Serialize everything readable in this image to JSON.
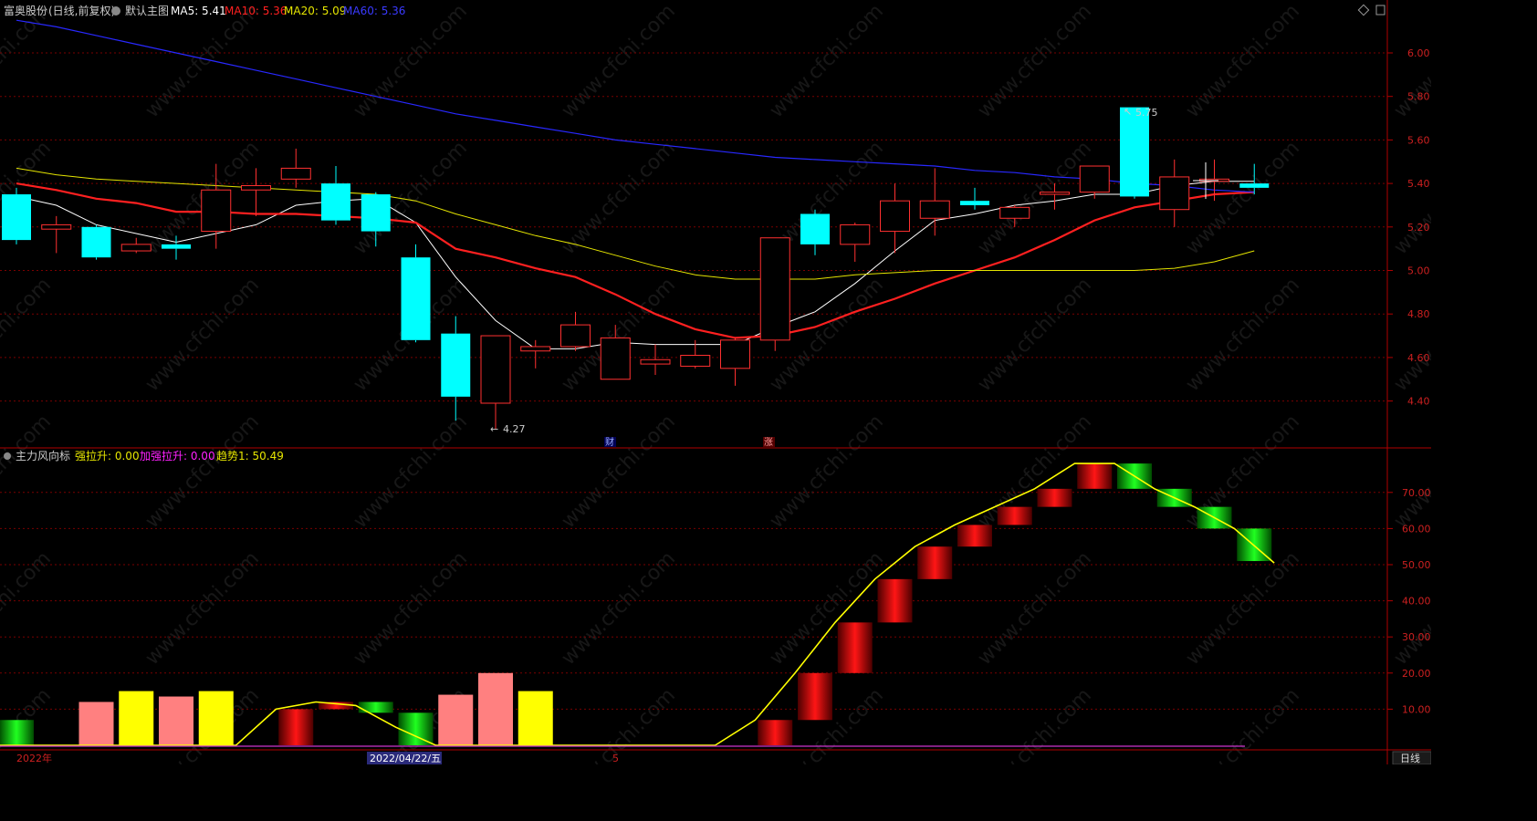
{
  "header": {
    "stock_name": "富奥股份",
    "period": "(日线,前复权)",
    "main_chart_label": "默认主图",
    "ma5": "MA5: 5.41",
    "ma10": "MA10: 5.36",
    "ma20": "MA20: 5.09",
    "ma60": "MA60: 5.36"
  },
  "sub_header": {
    "indicator_name": "主力风向标",
    "strong_pull": "强拉升: 0.00",
    "accel_pull": "加强拉升: 0.00",
    "trend": "趋势1: 50.49"
  },
  "annotations": {
    "high_label": "5.75",
    "low_label": "4.27",
    "marker_cai": "财",
    "marker_zhang": "涨"
  },
  "x_axis": {
    "year_label": "2022年",
    "cursor_date": "2022/04/22/五",
    "month_label": "5",
    "period_button": "日线"
  },
  "watermark": "www.cfchi.com",
  "colors": {
    "up": "#ff3030",
    "down": "#00ffff",
    "ma5": "#ffffff",
    "ma10": "#ff2020",
    "ma20": "#e5e500",
    "ma60": "#2828ff",
    "trend": "#ffff00",
    "grid": "#7a0000",
    "axis": "#b00000"
  },
  "chart_data": [
    {
      "type": "candlestick",
      "y_ticks": [
        "6.00",
        "5.80",
        "5.60",
        "5.40",
        "5.20",
        "5.00",
        "4.80",
        "4.60",
        "4.40"
      ],
      "ylim": [
        4.2,
        6.2
      ],
      "candles": [
        {
          "o": 5.35,
          "h": 5.38,
          "l": 5.12,
          "c": 5.14
        },
        {
          "o": 5.19,
          "h": 5.25,
          "l": 5.08,
          "c": 5.21
        },
        {
          "o": 5.2,
          "h": 5.21,
          "l": 5.05,
          "c": 5.06
        },
        {
          "o": 5.09,
          "h": 5.15,
          "l": 5.08,
          "c": 5.12
        },
        {
          "o": 5.12,
          "h": 5.16,
          "l": 5.05,
          "c": 5.1
        },
        {
          "o": 5.18,
          "h": 5.49,
          "l": 5.1,
          "c": 5.37
        },
        {
          "o": 5.37,
          "h": 5.47,
          "l": 5.25,
          "c": 5.39
        },
        {
          "o": 5.42,
          "h": 5.56,
          "l": 5.38,
          "c": 5.47
        },
        {
          "o": 5.4,
          "h": 5.48,
          "l": 5.21,
          "c": 5.23
        },
        {
          "o": 5.35,
          "h": 5.36,
          "l": 5.11,
          "c": 5.18
        },
        {
          "o": 5.06,
          "h": 5.12,
          "l": 4.67,
          "c": 4.68
        },
        {
          "o": 4.71,
          "h": 4.79,
          "l": 4.31,
          "c": 4.42
        },
        {
          "o": 4.39,
          "h": 4.7,
          "l": 4.27,
          "c": 4.7
        },
        {
          "o": 4.63,
          "h": 4.68,
          "l": 4.55,
          "c": 4.65
        },
        {
          "o": 4.65,
          "h": 4.81,
          "l": 4.63,
          "c": 4.75
        },
        {
          "o": 4.5,
          "h": 4.75,
          "l": 4.5,
          "c": 4.69
        },
        {
          "o": 4.57,
          "h": 4.66,
          "l": 4.52,
          "c": 4.59
        },
        {
          "o": 4.56,
          "h": 4.68,
          "l": 4.55,
          "c": 4.61
        },
        {
          "o": 4.55,
          "h": 4.69,
          "l": 4.47,
          "c": 4.68
        },
        {
          "o": 4.68,
          "h": 5.15,
          "l": 4.63,
          "c": 5.15
        },
        {
          "o": 5.26,
          "h": 5.28,
          "l": 5.07,
          "c": 5.12
        },
        {
          "o": 5.12,
          "h": 5.22,
          "l": 5.04,
          "c": 5.21
        },
        {
          "o": 5.18,
          "h": 5.4,
          "l": 5.08,
          "c": 5.32
        },
        {
          "o": 5.24,
          "h": 5.47,
          "l": 5.16,
          "c": 5.32
        },
        {
          "o": 5.32,
          "h": 5.38,
          "l": 5.28,
          "c": 5.3
        },
        {
          "o": 5.24,
          "h": 5.3,
          "l": 5.2,
          "c": 5.29
        },
        {
          "o": 5.35,
          "h": 5.4,
          "l": 5.28,
          "c": 5.36
        },
        {
          "o": 5.36,
          "h": 5.48,
          "l": 5.33,
          "c": 5.48
        },
        {
          "o": 5.75,
          "h": 5.75,
          "l": 5.33,
          "c": 5.34
        },
        {
          "o": 5.28,
          "h": 5.51,
          "l": 5.2,
          "c": 5.43
        },
        {
          "o": 5.41,
          "h": 5.51,
          "l": 5.32,
          "c": 5.42
        },
        {
          "o": 5.4,
          "h": 5.49,
          "l": 5.35,
          "c": 5.38
        }
      ],
      "series": [
        {
          "name": "MA5",
          "values": [
            5.34,
            5.3,
            5.21,
            5.17,
            5.13,
            5.17,
            5.21,
            5.3,
            5.32,
            5.33,
            5.22,
            4.97,
            4.77,
            4.64,
            4.64,
            4.67,
            4.66,
            4.66,
            4.66,
            4.74,
            4.81,
            4.94,
            5.09,
            5.23,
            5.26,
            5.3,
            5.32,
            5.35,
            5.35,
            5.39,
            5.41,
            5.41
          ]
        },
        {
          "name": "MA10",
          "values": [
            5.4,
            5.37,
            5.33,
            5.31,
            5.27,
            5.27,
            5.26,
            5.26,
            5.25,
            5.24,
            5.22,
            5.1,
            5.06,
            5.01,
            4.97,
            4.89,
            4.8,
            4.73,
            4.69,
            4.7,
            4.74,
            4.81,
            4.87,
            4.94,
            5.0,
            5.06,
            5.14,
            5.23,
            5.29,
            5.32,
            5.35,
            5.36
          ]
        },
        {
          "name": "MA20",
          "values": [
            5.47,
            5.44,
            5.42,
            5.41,
            5.4,
            5.39,
            5.38,
            5.37,
            5.36,
            5.35,
            5.32,
            5.26,
            5.21,
            5.16,
            5.12,
            5.07,
            5.02,
            4.98,
            4.96,
            4.96,
            4.96,
            4.98,
            4.99,
            5.0,
            5.0,
            5.0,
            5.0,
            5.0,
            5.0,
            5.01,
            5.04,
            5.09
          ]
        },
        {
          "name": "MA60",
          "values": [
            6.15,
            6.12,
            6.08,
            6.04,
            6.0,
            5.96,
            5.92,
            5.88,
            5.84,
            5.8,
            5.76,
            5.72,
            5.69,
            5.66,
            5.63,
            5.6,
            5.58,
            5.56,
            5.54,
            5.52,
            5.51,
            5.5,
            5.49,
            5.48,
            5.46,
            5.45,
            5.43,
            5.42,
            5.4,
            5.39,
            5.37,
            5.36
          ]
        }
      ]
    },
    {
      "type": "bar",
      "title": "主力风向标",
      "y_ticks": [
        "70.00",
        "60.00",
        "50.00",
        "40.00",
        "30.00",
        "20.00",
        "10.00"
      ],
      "ylim": [
        0,
        80
      ],
      "bars": [
        {
          "lo": 0,
          "hi": 7,
          "color": "green"
        },
        {
          "lo": 0,
          "hi": 0,
          "color": "none"
        },
        {
          "lo": 0,
          "hi": 12,
          "color": "pink"
        },
        {
          "lo": 0,
          "hi": 15,
          "color": "yellow"
        },
        {
          "lo": 0,
          "hi": 13.5,
          "color": "pink"
        },
        {
          "lo": 0,
          "hi": 15,
          "color": "yellow"
        },
        {
          "lo": 0,
          "hi": 0,
          "color": "none"
        },
        {
          "lo": 0,
          "hi": 10,
          "color": "red"
        },
        {
          "lo": 10,
          "hi": 12,
          "color": "red"
        },
        {
          "lo": 9,
          "hi": 12,
          "color": "green"
        },
        {
          "lo": 0,
          "hi": 9,
          "color": "green"
        },
        {
          "lo": 0,
          "hi": 14,
          "color": "pink"
        },
        {
          "lo": 0,
          "hi": 20,
          "color": "pink"
        },
        {
          "lo": 0,
          "hi": 15,
          "color": "yellow"
        },
        {
          "lo": 0,
          "hi": 0,
          "color": "none"
        },
        {
          "lo": 0,
          "hi": 0,
          "color": "none"
        },
        {
          "lo": 0,
          "hi": 0,
          "color": "none"
        },
        {
          "lo": 0,
          "hi": 0,
          "color": "none"
        },
        {
          "lo": 0,
          "hi": 0,
          "color": "none"
        },
        {
          "lo": 0,
          "hi": 7,
          "color": "red"
        },
        {
          "lo": 7,
          "hi": 20,
          "color": "red"
        },
        {
          "lo": 20,
          "hi": 34,
          "color": "red"
        },
        {
          "lo": 34,
          "hi": 46,
          "color": "red"
        },
        {
          "lo": 46,
          "hi": 55,
          "color": "red"
        },
        {
          "lo": 55,
          "hi": 61,
          "color": "red"
        },
        {
          "lo": 61,
          "hi": 66,
          "color": "red"
        },
        {
          "lo": 66,
          "hi": 71,
          "color": "red"
        },
        {
          "lo": 71,
          "hi": 78,
          "color": "red"
        },
        {
          "lo": 71,
          "hi": 78,
          "color": "green"
        },
        {
          "lo": 66,
          "hi": 71,
          "color": "green"
        },
        {
          "lo": 60,
          "hi": 66,
          "color": "green"
        },
        {
          "lo": 51,
          "hi": 60,
          "color": "green"
        }
      ],
      "series": [
        {
          "name": "趋势1",
          "values": [
            0,
            0,
            0,
            0,
            0,
            0,
            0,
            10,
            12,
            11,
            5,
            0,
            0,
            0,
            0,
            0,
            0,
            0,
            0,
            7,
            20,
            34,
            46,
            55,
            61,
            66,
            71,
            78,
            78,
            71,
            66,
            60,
            50.49
          ]
        }
      ]
    }
  ]
}
